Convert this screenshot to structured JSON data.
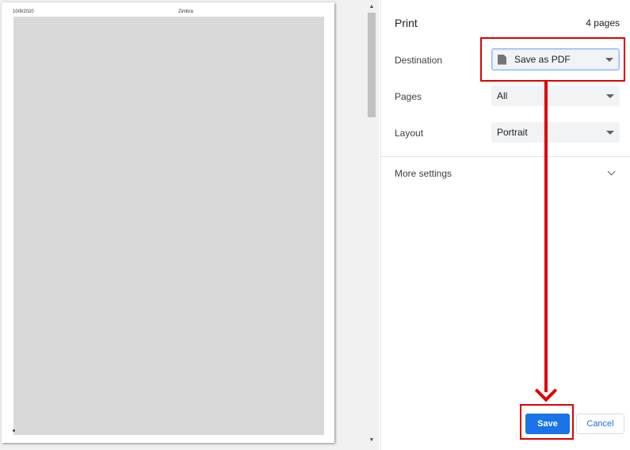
{
  "preview": {
    "page_header_date": "10/8/2020",
    "page_header_title": "Zimbra"
  },
  "print_panel": {
    "title": "Print",
    "sheet_count": "4 pages",
    "destination": {
      "label": "Destination",
      "value": "Save as PDF",
      "icon": "document-icon"
    },
    "pages": {
      "label": "Pages",
      "value": "All"
    },
    "layout": {
      "label": "Layout",
      "value": "Portrait"
    },
    "more_settings": {
      "label": "More settings",
      "icon": "chevron-down-icon"
    },
    "save_label": "Save",
    "cancel_label": "Cancel"
  },
  "colors": {
    "accent": "#1a73e8",
    "annotation": "#e00000",
    "preview_background": "#f1f1f1",
    "select_background": "#f1f3f4"
  }
}
